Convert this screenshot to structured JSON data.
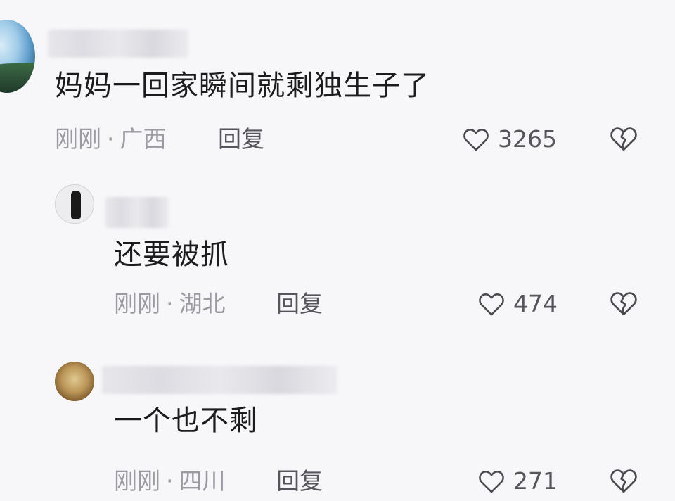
{
  "comments": [
    {
      "content": "妈妈一回家瞬间就剩独生子了",
      "time": "刚刚",
      "location": "广西",
      "reply_label": "回复",
      "likes": "3265"
    },
    {
      "content": "还要被抓",
      "time": "刚刚",
      "location": "湖北",
      "reply_label": "回复",
      "likes": "474"
    },
    {
      "content": "一个也不剩",
      "time": "刚刚",
      "location": "四川",
      "reply_label": "回复",
      "likes": "271"
    }
  ],
  "separator": "·",
  "icons": {
    "like": "heart-outline-icon",
    "dislike": "broken-heart-icon"
  },
  "colors": {
    "background": "#f7f7f9",
    "text_primary": "#1c1c1e",
    "text_meta": "#9a9aa1",
    "text_action": "#55555c"
  }
}
